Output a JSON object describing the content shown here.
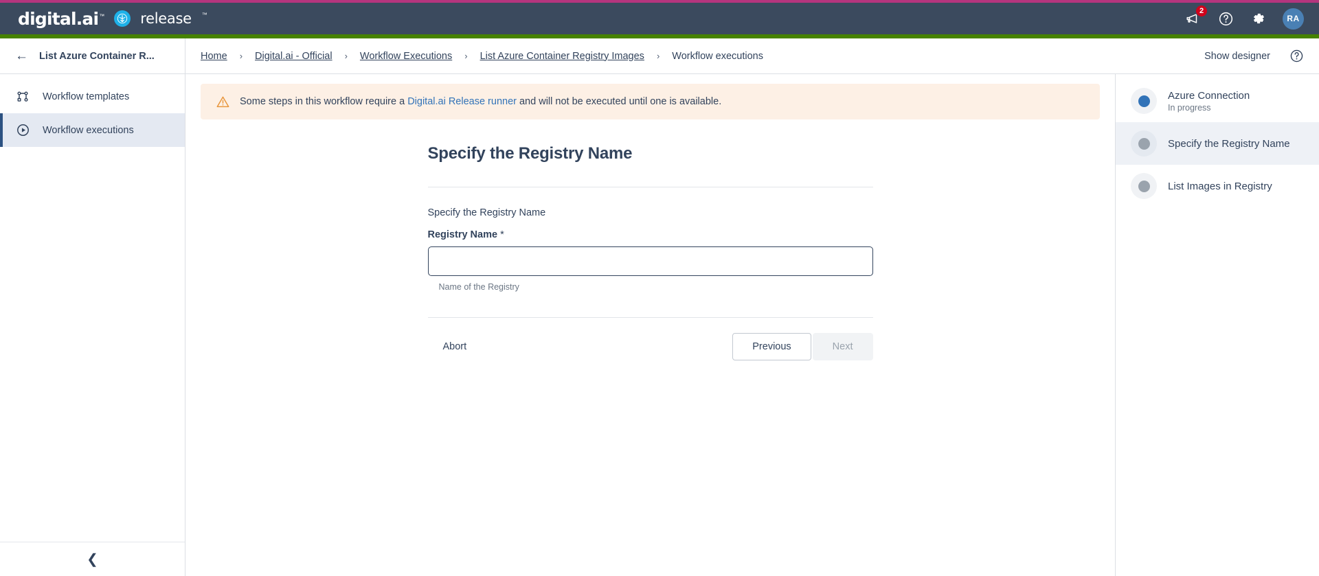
{
  "brand": {
    "company": "digital.ai",
    "product": "release",
    "logo_icon": "release-logo-icon"
  },
  "header": {
    "announcements_icon": "megaphone-icon",
    "announcements_badge": "2",
    "help_icon": "question-circle-icon",
    "settings_icon": "gear-icon",
    "avatar_initials": "RA",
    "accent_color": "#b5357e",
    "bar_color": "#3b4a5e",
    "underline_color": "#468200"
  },
  "crumb": {
    "back_icon": "arrow-left-icon",
    "title": "List Azure Container R...",
    "path": [
      {
        "label": "Home",
        "current": false
      },
      {
        "label": "Digital.ai - Official",
        "current": false
      },
      {
        "label": "Workflow Executions",
        "current": false
      },
      {
        "label": "List Azure Container Registry Images",
        "current": false
      },
      {
        "label": "Workflow executions",
        "current": true
      }
    ],
    "separator": "›",
    "show_designer": "Show designer",
    "help_icon": "question-circle-icon"
  },
  "sidebar": {
    "items": [
      {
        "label": "Workflow templates",
        "icon": "workflow-nodes-icon",
        "active": false
      },
      {
        "label": "Workflow executions",
        "icon": "play-circle-icon",
        "active": true
      }
    ],
    "collapse_icon": "chevron-left-icon"
  },
  "banner": {
    "icon": "warning-triangle-icon",
    "text_before": "Some steps in this workflow require a ",
    "link": "Digital.ai Release runner",
    "text_after": " and will not be executed until one is available.",
    "bg_color": "#fdf0e5",
    "icon_color": "#e8963c"
  },
  "form": {
    "title": "Specify the Registry Name",
    "subtitle": "Specify the Registry Name",
    "field_label": "Registry Name",
    "required_marker": "*",
    "field_value": "",
    "field_placeholder": "",
    "field_help": "Name of the Registry",
    "abort_label": "Abort",
    "previous_label": "Previous",
    "next_label": "Next",
    "next_disabled": true
  },
  "steps": {
    "items": [
      {
        "name": "Azure Connection",
        "status": "In progress",
        "state": "inprogress",
        "active": false
      },
      {
        "name": "Specify the Registry Name",
        "status": "",
        "state": "pending",
        "active": true
      },
      {
        "name": "List Images in Registry",
        "status": "",
        "state": "pending",
        "active": false
      }
    ]
  }
}
